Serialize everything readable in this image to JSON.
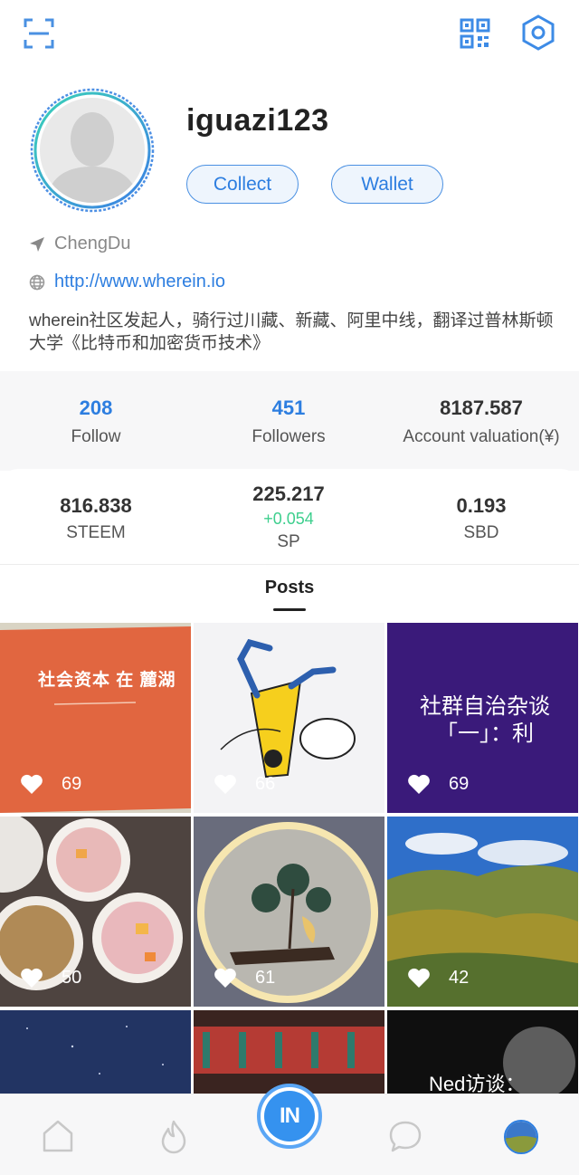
{
  "profile": {
    "username": "iguazi123",
    "collect_label": "Collect",
    "wallet_label": "Wallet",
    "location": "ChengDu",
    "website": "http://www.wherein.io",
    "bio": "wherein社区发起人，骑行过川藏、新藏、阿里中线，翻译过普林斯顿大学《比特币和加密货币技术》"
  },
  "stats": {
    "follow": {
      "value": "208",
      "label": "Follow"
    },
    "followers": {
      "value": "451",
      "label": "Followers"
    },
    "valuation": {
      "value": "8187.587",
      "label": "Account valuation(¥)"
    }
  },
  "wallet": {
    "steem": {
      "value": "816.838",
      "label": "STEEM"
    },
    "sp": {
      "value": "225.217",
      "delta": "+0.054",
      "label": "SP"
    },
    "sbd": {
      "value": "0.193",
      "label": "SBD"
    }
  },
  "tabs": {
    "posts": "Posts"
  },
  "posts": [
    {
      "likes": "69",
      "caption": "社会资本 在 麓湖"
    },
    {
      "likes": "66"
    },
    {
      "likes": "69",
      "caption": "社群自治杂谈「一」：利"
    },
    {
      "likes": "50"
    },
    {
      "likes": "61"
    },
    {
      "likes": "42"
    },
    {
      "likes": ""
    },
    {
      "likes": ""
    },
    {
      "likes": "",
      "caption": "Ned访谈："
    }
  ],
  "colors": {
    "accent": "#2d7ee0",
    "positive": "#3ecf8e",
    "tile_purple": "#3a1a7a",
    "tile_orange": "#e2683f"
  },
  "icons": [
    "scan-icon",
    "qr-code-icon",
    "settings-hexagon-icon",
    "location-arrow-icon",
    "globe-icon",
    "heart-icon",
    "home-icon",
    "flame-icon",
    "chat-icon"
  ]
}
